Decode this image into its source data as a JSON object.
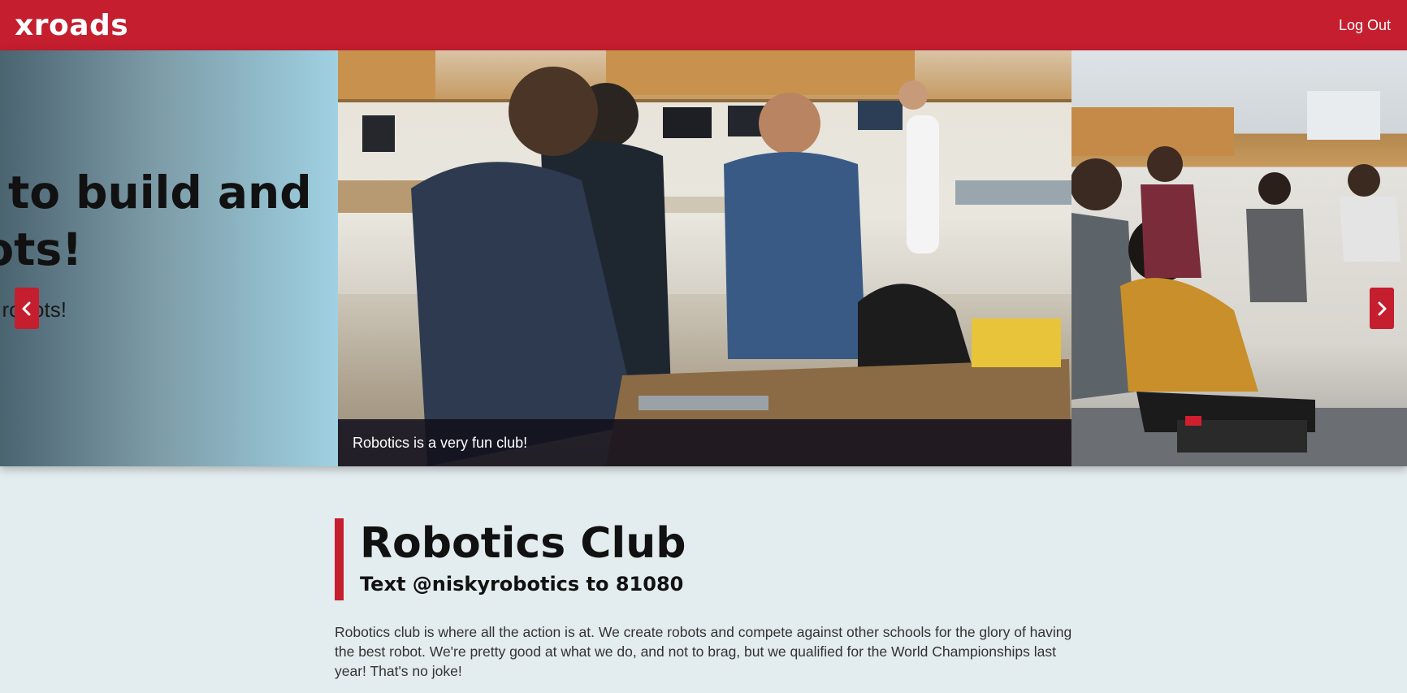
{
  "app": {
    "logo": "xroads",
    "logout_label": "Log Out"
  },
  "carousel": {
    "slide_text": {
      "headline_line1": "w to build and",
      "headline_line2": "bots!",
      "subtext": "le robots!"
    },
    "slide_photo": {
      "caption": "Robotics is a very fun club!"
    },
    "prev_icon": "chevron-left-icon",
    "next_icon": "chevron-right-icon"
  },
  "club": {
    "title": "Robotics Club",
    "subtitle": "Text @niskyrobotics to 81080",
    "description": "Robotics club is where all the action is at. We create robots and compete against other schools for the glory of having the best robot. We're pretty good at what we do, and not to brag, but we qualified for the World Championships last year! That's no joke!"
  },
  "colors": {
    "brand_red": "#c41e2f",
    "page_bg": "#e3ecee"
  }
}
